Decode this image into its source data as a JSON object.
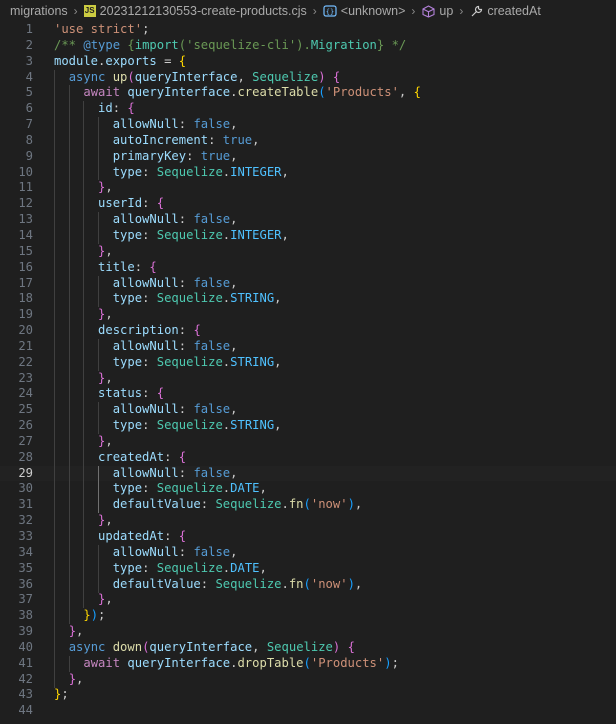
{
  "breadcrumb": {
    "folder": "migrations",
    "file": "20231212130553-create-products.cjs",
    "symbol1": "<unknown>",
    "symbol2": "up",
    "symbol3": "createdAt"
  },
  "editor": {
    "current_line": 29,
    "lines": [
      {
        "n": "1",
        "tokens": [
          [
            "s",
            "'use strict'"
          ],
          [
            "d",
            ";"
          ]
        ]
      },
      {
        "n": "2",
        "tokens": [
          [
            "m",
            "/** "
          ],
          [
            "ann",
            "@type"
          ],
          [
            "m",
            " {"
          ],
          [
            "t",
            "import"
          ],
          [
            "m",
            "('sequelize-cli')."
          ],
          [
            "t",
            "Migration"
          ],
          [
            "m",
            "} */"
          ]
        ]
      },
      {
        "n": "3",
        "tokens": [
          [
            "p",
            "module"
          ],
          [
            "d",
            "."
          ],
          [
            "p",
            "exports"
          ],
          [
            "d",
            " = "
          ],
          [
            "b1",
            "{"
          ]
        ]
      },
      {
        "n": "4",
        "tokens": [
          [
            "d",
            "  "
          ],
          [
            "k",
            "async"
          ],
          [
            "d",
            " "
          ],
          [
            "f",
            "up"
          ],
          [
            "b2",
            "("
          ],
          [
            "p",
            "queryInterface"
          ],
          [
            "d",
            ", "
          ],
          [
            "t",
            "Sequelize"
          ],
          [
            "b2",
            ")"
          ],
          [
            "d",
            " "
          ],
          [
            "b2",
            "{"
          ]
        ]
      },
      {
        "n": "5",
        "tokens": [
          [
            "d",
            "    "
          ],
          [
            "c",
            "await"
          ],
          [
            "d",
            " "
          ],
          [
            "p",
            "queryInterface"
          ],
          [
            "d",
            "."
          ],
          [
            "f",
            "createTable"
          ],
          [
            "b3",
            "("
          ],
          [
            "s",
            "'Products'"
          ],
          [
            "d",
            ", "
          ],
          [
            "b1",
            "{"
          ]
        ]
      },
      {
        "n": "6",
        "tokens": [
          [
            "d",
            "      "
          ],
          [
            "p",
            "id"
          ],
          [
            "d",
            ": "
          ],
          [
            "b2",
            "{"
          ]
        ]
      },
      {
        "n": "7",
        "tokens": [
          [
            "d",
            "        "
          ],
          [
            "p",
            "allowNull"
          ],
          [
            "d",
            ": "
          ],
          [
            "k",
            "false"
          ],
          [
            "d",
            ","
          ]
        ]
      },
      {
        "n": "8",
        "tokens": [
          [
            "d",
            "        "
          ],
          [
            "p",
            "autoIncrement"
          ],
          [
            "d",
            ": "
          ],
          [
            "k",
            "true"
          ],
          [
            "d",
            ","
          ]
        ]
      },
      {
        "n": "9",
        "tokens": [
          [
            "d",
            "        "
          ],
          [
            "p",
            "primaryKey"
          ],
          [
            "d",
            ": "
          ],
          [
            "k",
            "true"
          ],
          [
            "d",
            ","
          ]
        ]
      },
      {
        "n": "10",
        "tokens": [
          [
            "d",
            "        "
          ],
          [
            "p",
            "type"
          ],
          [
            "d",
            ": "
          ],
          [
            "t",
            "Sequelize"
          ],
          [
            "d",
            "."
          ],
          [
            "v",
            "INTEGER"
          ],
          [
            "d",
            ","
          ]
        ]
      },
      {
        "n": "11",
        "tokens": [
          [
            "d",
            "      "
          ],
          [
            "b2",
            "}"
          ],
          [
            "d",
            ","
          ]
        ]
      },
      {
        "n": "12",
        "tokens": [
          [
            "d",
            "      "
          ],
          [
            "p",
            "userId"
          ],
          [
            "d",
            ": "
          ],
          [
            "b2",
            "{"
          ]
        ]
      },
      {
        "n": "13",
        "tokens": [
          [
            "d",
            "        "
          ],
          [
            "p",
            "allowNull"
          ],
          [
            "d",
            ": "
          ],
          [
            "k",
            "false"
          ],
          [
            "d",
            ","
          ]
        ]
      },
      {
        "n": "14",
        "tokens": [
          [
            "d",
            "        "
          ],
          [
            "p",
            "type"
          ],
          [
            "d",
            ": "
          ],
          [
            "t",
            "Sequelize"
          ],
          [
            "d",
            "."
          ],
          [
            "v",
            "INTEGER"
          ],
          [
            "d",
            ","
          ]
        ]
      },
      {
        "n": "15",
        "tokens": [
          [
            "d",
            "      "
          ],
          [
            "b2",
            "}"
          ],
          [
            "d",
            ","
          ]
        ]
      },
      {
        "n": "16",
        "tokens": [
          [
            "d",
            "      "
          ],
          [
            "p",
            "title"
          ],
          [
            "d",
            ": "
          ],
          [
            "b2",
            "{"
          ]
        ]
      },
      {
        "n": "17",
        "tokens": [
          [
            "d",
            "        "
          ],
          [
            "p",
            "allowNull"
          ],
          [
            "d",
            ": "
          ],
          [
            "k",
            "false"
          ],
          [
            "d",
            ","
          ]
        ]
      },
      {
        "n": "18",
        "tokens": [
          [
            "d",
            "        "
          ],
          [
            "p",
            "type"
          ],
          [
            "d",
            ": "
          ],
          [
            "t",
            "Sequelize"
          ],
          [
            "d",
            "."
          ],
          [
            "v",
            "STRING"
          ],
          [
            "d",
            ","
          ]
        ]
      },
      {
        "n": "19",
        "tokens": [
          [
            "d",
            "      "
          ],
          [
            "b2",
            "}"
          ],
          [
            "d",
            ","
          ]
        ]
      },
      {
        "n": "20",
        "tokens": [
          [
            "d",
            "      "
          ],
          [
            "p",
            "description"
          ],
          [
            "d",
            ": "
          ],
          [
            "b2",
            "{"
          ]
        ]
      },
      {
        "n": "21",
        "tokens": [
          [
            "d",
            "        "
          ],
          [
            "p",
            "allowNull"
          ],
          [
            "d",
            ": "
          ],
          [
            "k",
            "false"
          ],
          [
            "d",
            ","
          ]
        ]
      },
      {
        "n": "22",
        "tokens": [
          [
            "d",
            "        "
          ],
          [
            "p",
            "type"
          ],
          [
            "d",
            ": "
          ],
          [
            "t",
            "Sequelize"
          ],
          [
            "d",
            "."
          ],
          [
            "v",
            "STRING"
          ],
          [
            "d",
            ","
          ]
        ]
      },
      {
        "n": "23",
        "tokens": [
          [
            "d",
            "      "
          ],
          [
            "b2",
            "}"
          ],
          [
            "d",
            ","
          ]
        ]
      },
      {
        "n": "24",
        "tokens": [
          [
            "d",
            "      "
          ],
          [
            "p",
            "status"
          ],
          [
            "d",
            ": "
          ],
          [
            "b2",
            "{"
          ]
        ]
      },
      {
        "n": "25",
        "tokens": [
          [
            "d",
            "        "
          ],
          [
            "p",
            "allowNull"
          ],
          [
            "d",
            ": "
          ],
          [
            "k",
            "false"
          ],
          [
            "d",
            ","
          ]
        ]
      },
      {
        "n": "26",
        "tokens": [
          [
            "d",
            "        "
          ],
          [
            "p",
            "type"
          ],
          [
            "d",
            ": "
          ],
          [
            "t",
            "Sequelize"
          ],
          [
            "d",
            "."
          ],
          [
            "v",
            "STRING"
          ],
          [
            "d",
            ","
          ]
        ]
      },
      {
        "n": "27",
        "tokens": [
          [
            "d",
            "      "
          ],
          [
            "b2",
            "}"
          ],
          [
            "d",
            ","
          ]
        ]
      },
      {
        "n": "28",
        "tokens": [
          [
            "d",
            "      "
          ],
          [
            "p",
            "createdAt"
          ],
          [
            "d",
            ": "
          ],
          [
            "b2",
            "{"
          ]
        ]
      },
      {
        "n": "29",
        "tokens": [
          [
            "d",
            "        "
          ],
          [
            "p",
            "allowNull"
          ],
          [
            "d",
            ": "
          ],
          [
            "k",
            "false"
          ],
          [
            "d",
            ","
          ]
        ]
      },
      {
        "n": "30",
        "tokens": [
          [
            "d",
            "        "
          ],
          [
            "p",
            "type"
          ],
          [
            "d",
            ": "
          ],
          [
            "t",
            "Sequelize"
          ],
          [
            "d",
            "."
          ],
          [
            "v",
            "DATE"
          ],
          [
            "d",
            ","
          ]
        ]
      },
      {
        "n": "31",
        "tokens": [
          [
            "d",
            "        "
          ],
          [
            "p",
            "defaultValue"
          ],
          [
            "d",
            ": "
          ],
          [
            "t",
            "Sequelize"
          ],
          [
            "d",
            "."
          ],
          [
            "f",
            "fn"
          ],
          [
            "b3",
            "("
          ],
          [
            "s",
            "'now'"
          ],
          [
            "b3",
            ")"
          ],
          [
            "d",
            ","
          ]
        ]
      },
      {
        "n": "32",
        "tokens": [
          [
            "d",
            "      "
          ],
          [
            "b2",
            "}"
          ],
          [
            "d",
            ","
          ]
        ]
      },
      {
        "n": "33",
        "tokens": [
          [
            "d",
            "      "
          ],
          [
            "p",
            "updatedAt"
          ],
          [
            "d",
            ": "
          ],
          [
            "b2",
            "{"
          ]
        ]
      },
      {
        "n": "34",
        "tokens": [
          [
            "d",
            "        "
          ],
          [
            "p",
            "allowNull"
          ],
          [
            "d",
            ": "
          ],
          [
            "k",
            "false"
          ],
          [
            "d",
            ","
          ]
        ]
      },
      {
        "n": "35",
        "tokens": [
          [
            "d",
            "        "
          ],
          [
            "p",
            "type"
          ],
          [
            "d",
            ": "
          ],
          [
            "t",
            "Sequelize"
          ],
          [
            "d",
            "."
          ],
          [
            "v",
            "DATE"
          ],
          [
            "d",
            ","
          ]
        ]
      },
      {
        "n": "36",
        "tokens": [
          [
            "d",
            "        "
          ],
          [
            "p",
            "defaultValue"
          ],
          [
            "d",
            ": "
          ],
          [
            "t",
            "Sequelize"
          ],
          [
            "d",
            "."
          ],
          [
            "f",
            "fn"
          ],
          [
            "b3",
            "("
          ],
          [
            "s",
            "'now'"
          ],
          [
            "b3",
            ")"
          ],
          [
            "d",
            ","
          ]
        ]
      },
      {
        "n": "37",
        "tokens": [
          [
            "d",
            "      "
          ],
          [
            "b2",
            "}"
          ],
          [
            "d",
            ","
          ]
        ]
      },
      {
        "n": "38",
        "tokens": [
          [
            "d",
            "    "
          ],
          [
            "b1",
            "}"
          ],
          [
            "b3",
            ")"
          ],
          [
            "d",
            ";"
          ]
        ]
      },
      {
        "n": "39",
        "tokens": [
          [
            "d",
            "  "
          ],
          [
            "b2",
            "}"
          ],
          [
            "d",
            ","
          ]
        ]
      },
      {
        "n": "40",
        "tokens": [
          [
            "d",
            "  "
          ],
          [
            "k",
            "async"
          ],
          [
            "d",
            " "
          ],
          [
            "f",
            "down"
          ],
          [
            "b2",
            "("
          ],
          [
            "p",
            "queryInterface"
          ],
          [
            "d",
            ", "
          ],
          [
            "t",
            "Sequelize"
          ],
          [
            "b2",
            ")"
          ],
          [
            "d",
            " "
          ],
          [
            "b2",
            "{"
          ]
        ]
      },
      {
        "n": "41",
        "tokens": [
          [
            "d",
            "    "
          ],
          [
            "c",
            "await"
          ],
          [
            "d",
            " "
          ],
          [
            "p",
            "queryInterface"
          ],
          [
            "d",
            "."
          ],
          [
            "f",
            "dropTable"
          ],
          [
            "b3",
            "("
          ],
          [
            "s",
            "'Products'"
          ],
          [
            "b3",
            ")"
          ],
          [
            "d",
            ";"
          ]
        ]
      },
      {
        "n": "42",
        "tokens": [
          [
            "d",
            "  "
          ],
          [
            "b2",
            "}"
          ],
          [
            "d",
            ","
          ]
        ]
      },
      {
        "n": "43",
        "tokens": [
          [
            "b1",
            "}"
          ],
          [
            "d",
            ";"
          ]
        ]
      },
      {
        "n": "44",
        "tokens": []
      }
    ]
  }
}
